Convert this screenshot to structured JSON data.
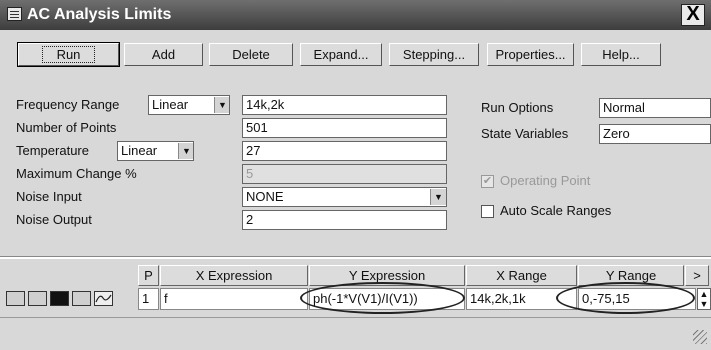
{
  "window": {
    "title": "AC Analysis Limits",
    "close_label": "X"
  },
  "toolbar": {
    "run": "Run",
    "add": "Add",
    "delete": "Delete",
    "expand": "Expand...",
    "stepping": "Stepping...",
    "properties": "Properties...",
    "help": "Help..."
  },
  "form": {
    "frequency_range": {
      "label": "Frequency Range",
      "mode": "Linear",
      "value": "14k,2k"
    },
    "number_of_points": {
      "label": "Number of Points",
      "value": "501"
    },
    "temperature": {
      "label": "Temperature",
      "mode": "Linear",
      "value": "27"
    },
    "maximum_change": {
      "label": "Maximum Change %",
      "value": "5"
    },
    "noise_input": {
      "label": "Noise Input",
      "value": "NONE"
    },
    "noise_output": {
      "label": "Noise Output",
      "value": "2"
    },
    "run_options": {
      "label": "Run Options",
      "value": "Normal"
    },
    "state_variables": {
      "label": "State Variables",
      "value": "Zero"
    },
    "operating_point": {
      "label": "Operating Point",
      "checked": true,
      "enabled": false
    },
    "auto_scale_ranges": {
      "label": "Auto Scale Ranges",
      "checked": false
    }
  },
  "table": {
    "columns": [
      "P",
      "X Expression",
      "Y Expression",
      "X Range",
      "Y Range",
      ">"
    ],
    "rows": [
      {
        "p": "1",
        "x_expression": "f",
        "y_expression": "ph(-1*V(V1)/I(V1))",
        "x_range": "14k,2k,1k",
        "y_range": "0,-75,15"
      }
    ]
  },
  "icons": {
    "title": "table-icon",
    "close": "close-icon",
    "plot_modes": [
      "mode-1-icon",
      "mode-2-icon",
      "mode-3-icon",
      "mode-4-icon",
      "waveform-icon"
    ]
  }
}
